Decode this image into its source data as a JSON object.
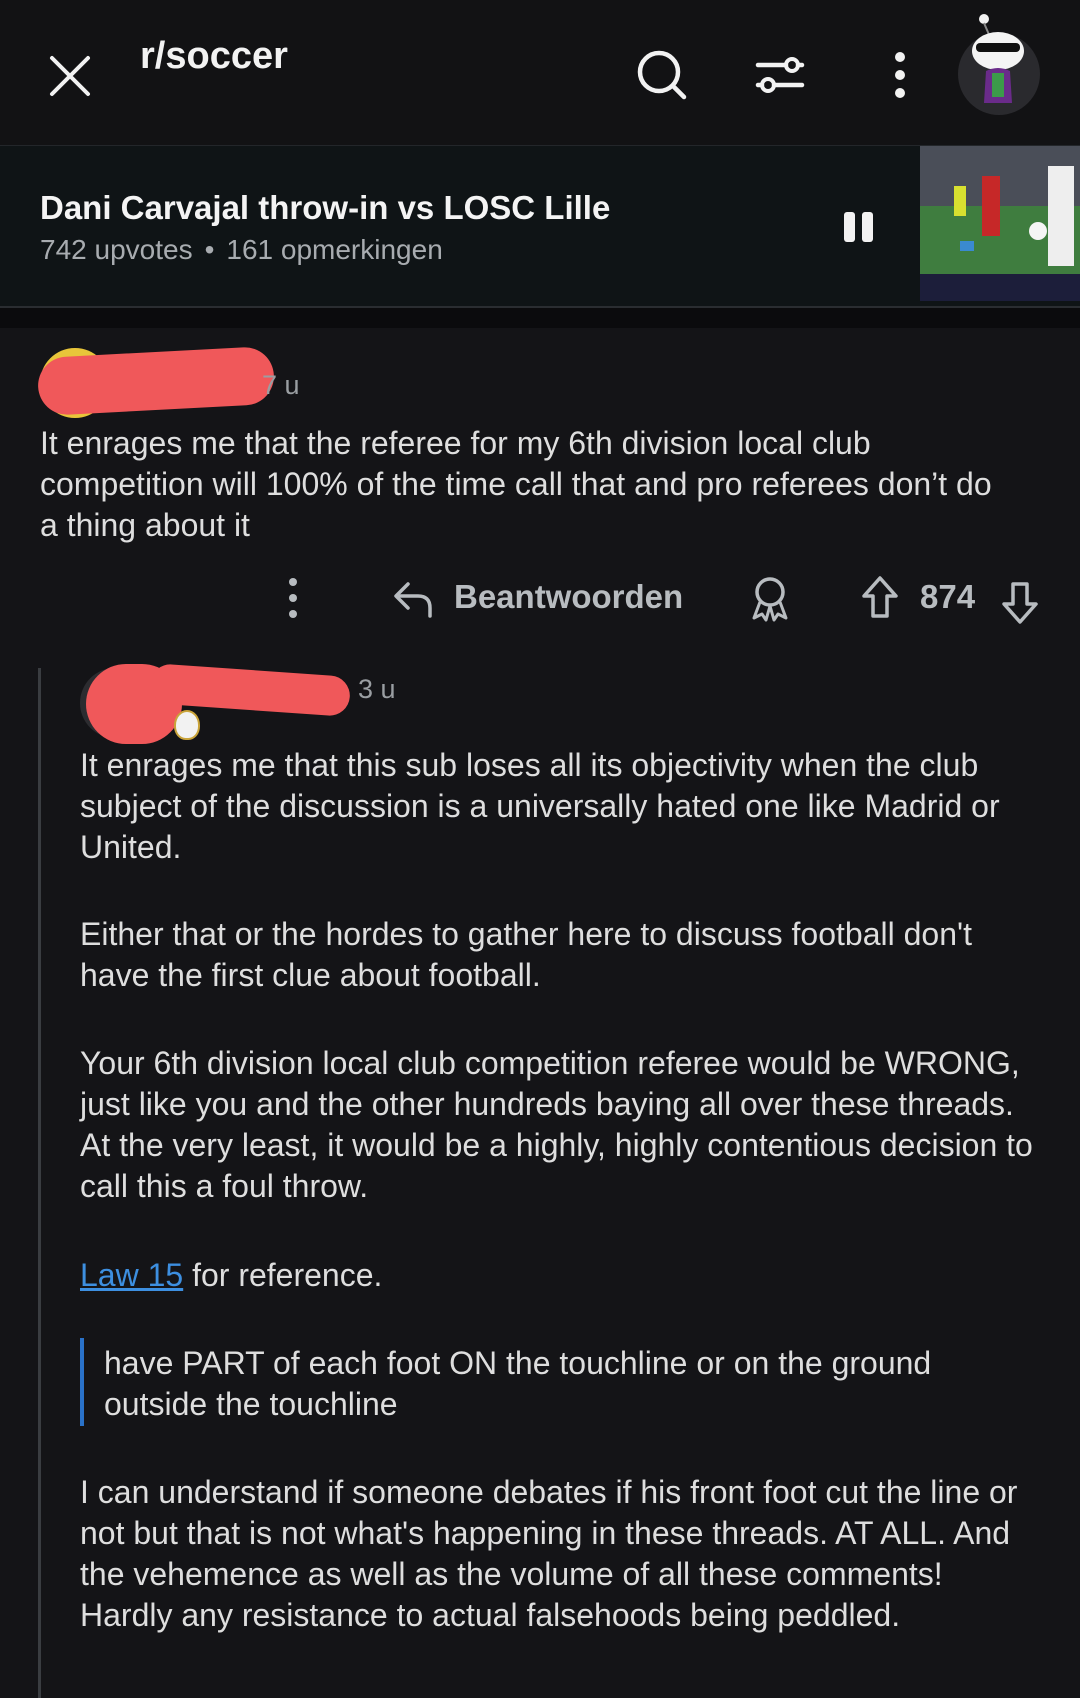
{
  "header": {
    "title": "r/soccer"
  },
  "player": {
    "title": "Dani Carvajal throw-in vs LOSC Lille",
    "upvotes": "742 upvotes",
    "separator": "•",
    "comments": "161 opmerkingen"
  },
  "comment1": {
    "time": "7 u",
    "text": "It enrages me that the referee for my 6th division local club competition will 100% of the time call that and pro referees don’t do a thing about it",
    "reply_label": "Beantwoorden",
    "score": "874"
  },
  "comment2": {
    "time": "3 u",
    "paragraphs": [
      "It enrages me that this sub loses all its objectivity when the club subject of the discussion is a universally hated one like Madrid or United.",
      "Either that or the hordes to gather here to discuss football don't have the first clue about football.",
      "Your 6th division local club competition referee would be WRONG, just like you and the other hundreds baying all over these threads. At the very least, it would be a highly, highly contentious decision to call this a foul throw."
    ],
    "link_text": "Law 15",
    "link_suffix": " for reference.",
    "quote": "have PART of each foot ON the touchline or on the ground outside the touchline",
    "last_paragraph": "I can understand if someone debates if his front foot cut the line or not but that is not what's happening in these threads. AT ALL. And the vehemence as well as the volume of all these comments! Hardly any resistance to actual falsehoods being peddled."
  },
  "icons": {
    "close": "close-icon",
    "search": "search-icon",
    "filter": "filter-icon",
    "more": "more-vertical-icon",
    "pause": "pause-icon",
    "reply": "reply-icon",
    "award": "award-icon",
    "upvote": "upvote-icon",
    "downvote": "downvote-icon"
  },
  "colors": {
    "background": "#141417",
    "link": "#3d8fe0",
    "quote_bar": "#2a72c9",
    "redaction": "#f0585a"
  }
}
